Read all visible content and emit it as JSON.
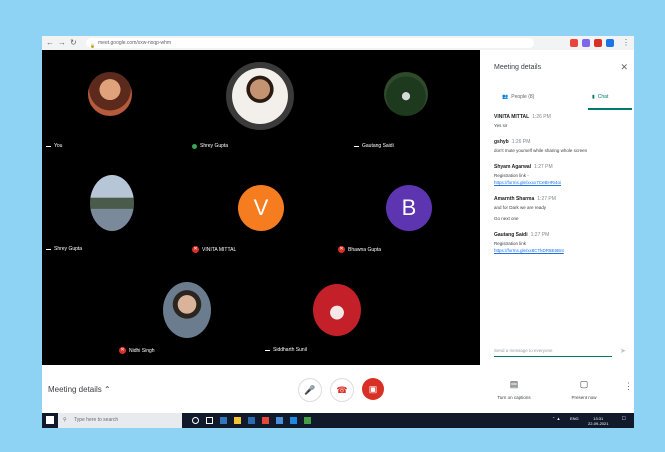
{
  "browser": {
    "url": "meet.google.com/xxw-nxqp-whm",
    "colors": {
      "bar": "#f1f3f4",
      "ext1": "#e8453c",
      "ext2": "#7b68ee",
      "ext3": "#d93025",
      "ext4": "#1a73e8"
    }
  },
  "participants": [
    {
      "name": "You",
      "avatar_type": "photo",
      "mic": "none",
      "color": "#b65a3c"
    },
    {
      "name": "Shrey Gupta",
      "avatar_type": "photo",
      "mic": "speaking",
      "color": "#e8e0d8"
    },
    {
      "name": "Gautang Saidi",
      "avatar_type": "photo",
      "mic": "none",
      "color": "#2e4a2a"
    },
    {
      "name": "Shrey Gupta",
      "avatar_type": "photo",
      "mic": "none",
      "color": "#7a8a9a"
    },
    {
      "name": "VINITA MITTAL",
      "avatar_type": "letter",
      "letter": "V",
      "mic": "muted",
      "color": "#f57c1f"
    },
    {
      "name": "Bhawna Gupta",
      "avatar_type": "letter",
      "letter": "B",
      "mic": "muted",
      "color": "#5e35b1"
    },
    {
      "name": "Nidhi Singh",
      "avatar_type": "photo",
      "mic": "muted",
      "color": "#6a7c8e"
    },
    {
      "name": "Siddharth Sunil",
      "avatar_type": "photo",
      "mic": "none",
      "color": "#c4202a"
    }
  ],
  "panel": {
    "title": "Meeting details",
    "close_icon": "close-icon",
    "tab_people": "People (8)",
    "tab_chat": "Chat",
    "messages": [
      {
        "sender": "VINITA MITTAL",
        "time": "1:26 PM",
        "text": "Yes sir",
        "link": ""
      },
      {
        "sender": "gshyb",
        "time": "1:26 PM",
        "text": "don't mute yourself while sharing whole screen",
        "link": ""
      },
      {
        "sender": "Shyam Agarwal",
        "time": "1:27 PM",
        "text": "Registration link -",
        "link": "https://forms.gle/xxxx7CeBHRi4oi"
      },
      {
        "sender": "Amarnth Sharma",
        "time": "1:27 PM",
        "text": "and for Dark we are ready",
        "link": ""
      },
      {
        "sender": "",
        "time": "",
        "text": "Go next one",
        "link": ""
      },
      {
        "sender": "Gautang Saidi",
        "time": "1:27 PM",
        "text": "Registration link",
        "link": "https://forms.gle/xx8CTkDR8E6Bnt"
      }
    ],
    "composer_placeholder": "Send a message to everyone",
    "accent": "#00796b"
  },
  "controls": {
    "meeting_details": "Meeting details",
    "captions_label": "Turn on captions",
    "present_label": "Present now",
    "end_color": "#d93025"
  },
  "taskbar": {
    "search_placeholder": "Type here to search",
    "time": "13:31",
    "date": "22-09-2021",
    "lang": "ENG"
  }
}
